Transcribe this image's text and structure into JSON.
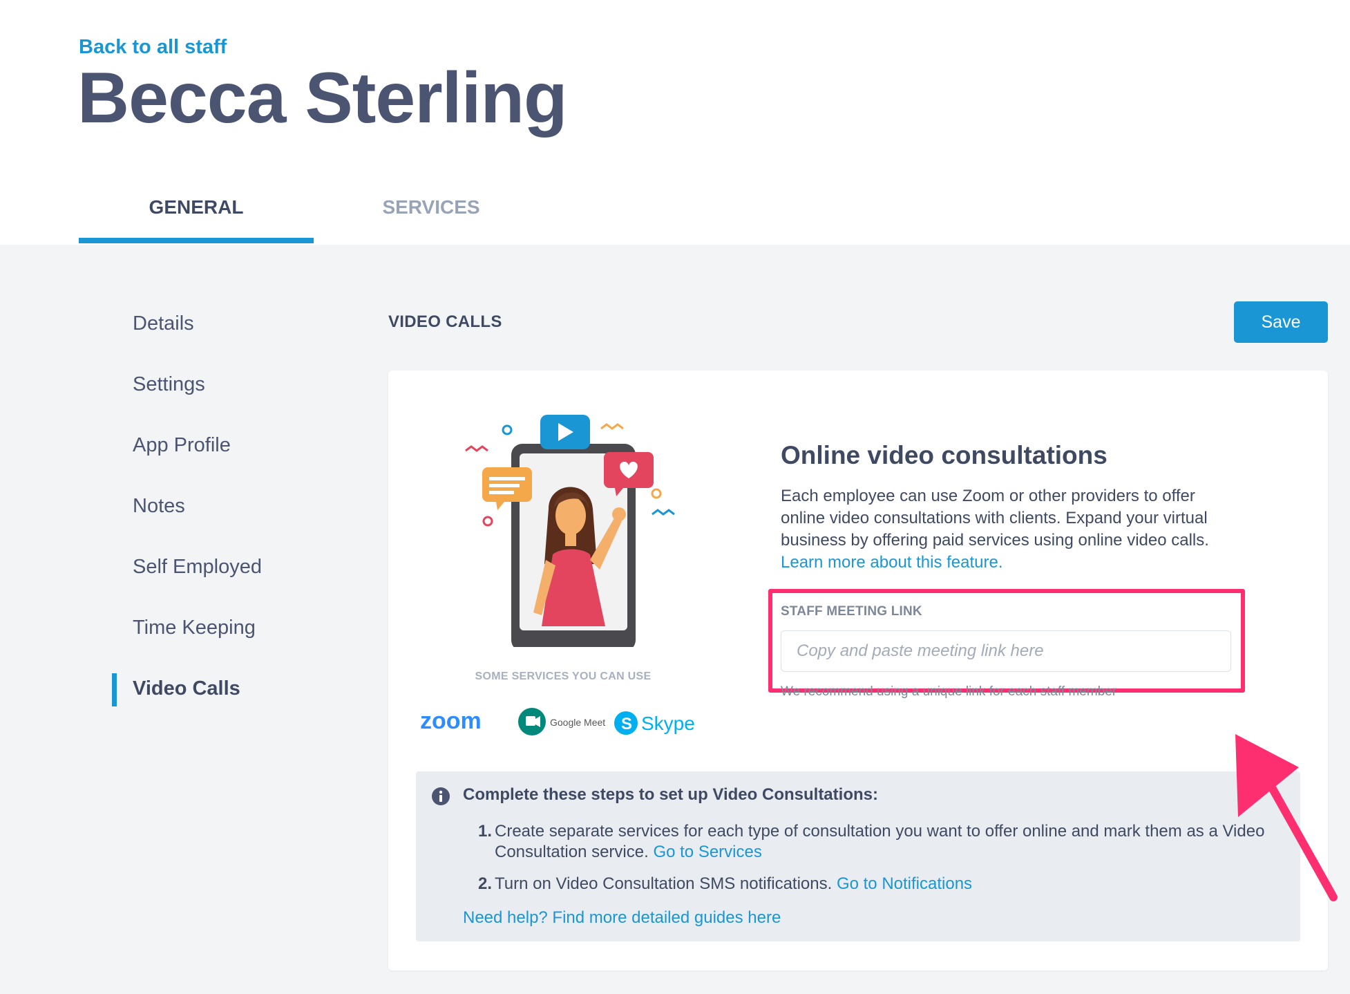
{
  "header": {
    "back_link": "Back to all staff",
    "title": "Becca Sterling"
  },
  "tabs": [
    {
      "label": "GENERAL",
      "active": true
    },
    {
      "label": "SERVICES",
      "active": false
    }
  ],
  "sidebar": {
    "items": [
      {
        "label": "Details"
      },
      {
        "label": "Settings"
      },
      {
        "label": "App Profile"
      },
      {
        "label": "Notes"
      },
      {
        "label": "Self Employed"
      },
      {
        "label": "Time Keeping"
      },
      {
        "label": "Video Calls",
        "active": true
      }
    ]
  },
  "main": {
    "section_heading": "VIDEO CALLS",
    "save_label": "Save",
    "illustration": {
      "caption": "SOME SERVICES YOU CAN USE",
      "logos": [
        "zoom",
        "Google Meet",
        "Skype"
      ]
    },
    "consult": {
      "title": "Online video consultations",
      "body": "Each employee can use Zoom or other providers to offer online video consultations with clients. Expand your virtual business by offering paid services using online video calls.",
      "learn_more": "Learn more about this feature."
    },
    "meeting_link": {
      "label": "STAFF MEETING LINK",
      "placeholder": "Copy and paste meeting link here",
      "value": "",
      "hint": "We recommend using a unique link for each staff member"
    },
    "steps": {
      "title": "Complete these steps to set up Video Consultations:",
      "items": [
        {
          "num": "1.",
          "text": "Create separate services for each type of consultation you want to offer online and mark them as a Video Consultation service.",
          "link": "Go to Services"
        },
        {
          "num": "2.",
          "text": "Turn on Video Consultation SMS notifications.",
          "link": "Go to Notifications"
        }
      ],
      "help_link": "Need help? Find more detailed guides here"
    }
  },
  "colors": {
    "accent": "#1a96d4",
    "highlight": "#fe2f70",
    "text": "#3f4a62",
    "background": "#f3f4f6"
  }
}
